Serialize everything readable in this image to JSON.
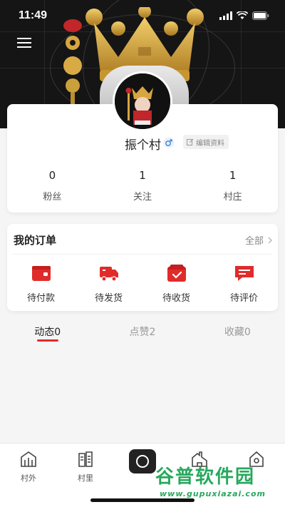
{
  "status_bar": {
    "time": "11:49"
  },
  "profile": {
    "username": "振个村",
    "edit_label": "编辑资料",
    "stats": [
      {
        "value": "0",
        "label": "粉丝"
      },
      {
        "value": "1",
        "label": "关注"
      },
      {
        "value": "1",
        "label": "村庄"
      }
    ]
  },
  "orders": {
    "title": "我的订单",
    "all_label": "全部",
    "items": [
      {
        "label": "待付款",
        "icon": "wallet-icon"
      },
      {
        "label": "待发货",
        "icon": "truck-icon"
      },
      {
        "label": "待收货",
        "icon": "box-check-icon"
      },
      {
        "label": "待评价",
        "icon": "comment-icon"
      }
    ]
  },
  "tabs": [
    {
      "label": "动态0",
      "active": true
    },
    {
      "label": "点赞2",
      "active": false
    },
    {
      "label": "收藏0",
      "active": false
    }
  ],
  "bottom_nav": [
    {
      "label": "村外",
      "icon": "village-outside-icon"
    },
    {
      "label": "村里",
      "icon": "village-inside-icon"
    },
    {
      "label": "",
      "icon": "camera-circle-icon"
    },
    {
      "label": "",
      "icon": "house-icon"
    },
    {
      "label": "",
      "icon": "profile-house-icon"
    }
  ],
  "watermark": {
    "logo": "谷普软件园",
    "url": "www.gupuxiazai.com"
  },
  "colors": {
    "accent": "#e12b2b",
    "watermark": "#27a85d",
    "header_bg": "#151515"
  }
}
